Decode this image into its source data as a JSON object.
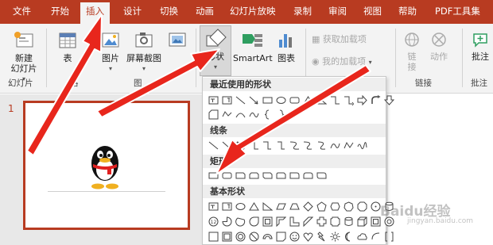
{
  "tabs": [
    "文件",
    "开始",
    "插入",
    "设计",
    "切换",
    "动画",
    "幻灯片放映",
    "录制",
    "审阅",
    "视图",
    "帮助",
    "PDF工具集"
  ],
  "ribbon": {
    "new_slide": "新建",
    "new_slide_2": "幻灯片",
    "group_slides": "幻灯片",
    "table_partial": "表",
    "group_table_partial": "格",
    "picture": "图片",
    "screenshot": "屏幕截图",
    "group_images_partial": "图",
    "shapes": "形状",
    "smartart": "SmartArt",
    "chart": "图表",
    "get_addins": "获取加载项",
    "my_addins": "我的加载项",
    "link": "链",
    "link_2": "接",
    "action": "动作",
    "group_links": "链接",
    "comment": "批注",
    "group_comments": "批注"
  },
  "slide": {
    "number": "1"
  },
  "dropdown": {
    "recent": "最近使用的形状",
    "lines": "线条",
    "rect": "矩形",
    "basic": "基本形状"
  },
  "watermark": "Baidu经验",
  "watermark_sub": "jingyan.baidu.com",
  "colors": {
    "accent": "#b83b21",
    "arrow": "#e8261c"
  }
}
